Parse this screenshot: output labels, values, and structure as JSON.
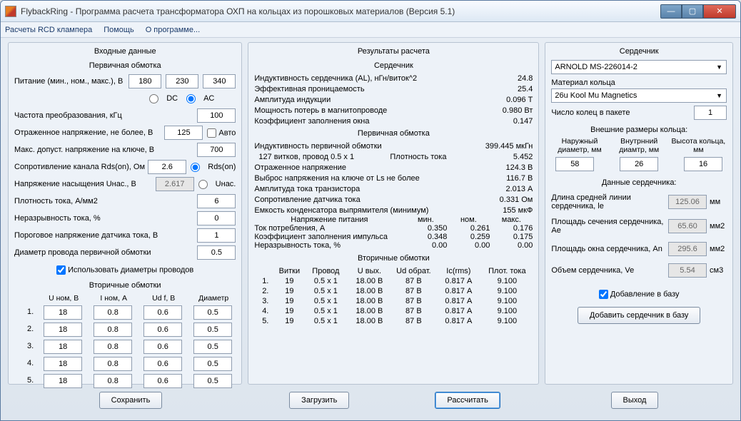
{
  "window": {
    "title": "FlybackRing - Программа расчета трансформатора ОХП на кольцах из порошковых материалов (Версия 5.1)"
  },
  "menu": {
    "rcd": "Расчеты RCD клампера",
    "help": "Помощь",
    "about": "О программе..."
  },
  "left": {
    "title": "Входные данные",
    "primary_heading": "Первичная обмотка",
    "supply_label": "Питание (мин., ном., макс.), В",
    "supply": {
      "min": "180",
      "nom": "230",
      "max": "340"
    },
    "dc_label": "DC",
    "ac_label": "AC",
    "ac_checked": true,
    "freq_label": "Частота преобразования, кГц",
    "freq": "100",
    "vrefl_label": "Отраженное напряжение, не более, В",
    "vrefl": "125",
    "auto_label": "Авто",
    "vds_label": "Макс. допуст. напряжение на ключе, В",
    "vds": "700",
    "rdson_label": "Сопротивление канала Rds(on), Ом",
    "rdson_val": "2.6",
    "rdson_radio": "Rds(on)",
    "usat_label": "Напряжение насыщения Uнас., В",
    "usat_val": "2.617",
    "usat_radio": "Uнас.",
    "jdens_label": "Плотность тока, А/мм2",
    "jdens": "6",
    "discont_label": "Неразрывность тока, %",
    "discont": "0",
    "vthr_label": "Пороговое напряжение датчика тока, В",
    "vthr": "1",
    "dprim_label": "Диаметр провода первичной обмотки",
    "dprim": "0.5",
    "use_diam_label": "Использовать диаметры проводов",
    "secondary_heading": "Вторичные обмотки",
    "sec_headers": [
      "U ном, В",
      "I ном, А",
      "Ud f, B",
      "Диаметр"
    ],
    "sec_rows": [
      {
        "n": "1.",
        "u": "18",
        "i": "0.8",
        "ud": "0.6",
        "d": "0.5"
      },
      {
        "n": "2.",
        "u": "18",
        "i": "0.8",
        "ud": "0.6",
        "d": "0.5"
      },
      {
        "n": "3.",
        "u": "18",
        "i": "0.8",
        "ud": "0.6",
        "d": "0.5"
      },
      {
        "n": "4.",
        "u": "18",
        "i": "0.8",
        "ud": "0.6",
        "d": "0.5"
      },
      {
        "n": "5.",
        "u": "18",
        "i": "0.8",
        "ud": "0.6",
        "d": "0.5"
      }
    ]
  },
  "mid": {
    "title": "Результаты расчета",
    "core_heading": "Сердечник",
    "al_label": "Индуктивность сердечника (AL), нГн/виток^2",
    "al": "24.8",
    "mueff_label": "Эффективная проницаемость",
    "mueff": "25.4",
    "bamp_label": "Амплитуда индукции",
    "bamp": "0.096 Т",
    "ploss_label": "Мощность потерь в магнитопроводе",
    "ploss": "0.980 Вт",
    "kfill_label": "Коэффициент заполнения окна",
    "kfill": "0.147",
    "prim_heading": "Первичная обмотка",
    "lprim_label": "Индуктивность первичной обмотки",
    "lprim": "399.445 мкГн",
    "turns_text": "127 витков, провод 0.5 x 1",
    "jtxt": "Плотность тока",
    "jval": "5.452",
    "vref_label": "Отраженное напряжение",
    "vref": "124.3 В",
    "vspike_label": "Выброс напряжения на ключе от Ls не более",
    "vspike": "116.7 В",
    "ipk_label": "Амплитуда тока транзистора",
    "ipk": "2.013 А",
    "rsense_label": "Сопротивление датчика тока",
    "rsense": "0.331 Ом",
    "crect_label": "Емкость конденсатора выпрямителя (минимум)",
    "crect": "155 мкФ",
    "supply3_label": "Напряжение питания",
    "col_min": "мин.",
    "col_nom": "ном.",
    "col_max": "макс.",
    "iin_label": "Ток потребления, А",
    "iin": [
      "0.350",
      "0.261",
      "0.176"
    ],
    "duty_label": "Коэффициент заполнения импульса",
    "duty": [
      "0.348",
      "0.259",
      "0.175"
    ],
    "cont_label": "Неразрывность тока, %",
    "cont": [
      "0.00",
      "0.00",
      "0.00"
    ],
    "sec_heading": "Вторичные обмотки",
    "sec_headers": [
      "Витки",
      "Провод",
      "U вых.",
      "Ud обрат.",
      "Ic(rms)",
      "Плот. тока"
    ],
    "sec_rows": [
      {
        "n": "1.",
        "turns": "19",
        "wire": "0.5 x 1",
        "uout": "18.00 В",
        "urev": "87 В",
        "ic": "0.817 А",
        "j": "9.100"
      },
      {
        "n": "2.",
        "turns": "19",
        "wire": "0.5 x 1",
        "uout": "18.00 В",
        "urev": "87 В",
        "ic": "0.817 А",
        "j": "9.100"
      },
      {
        "n": "3.",
        "turns": "19",
        "wire": "0.5 x 1",
        "uout": "18.00 В",
        "urev": "87 В",
        "ic": "0.817 А",
        "j": "9.100"
      },
      {
        "n": "4.",
        "turns": "19",
        "wire": "0.5 x 1",
        "uout": "18.00 В",
        "urev": "87 В",
        "ic": "0.817 А",
        "j": "9.100"
      },
      {
        "n": "5.",
        "turns": "19",
        "wire": "0.5 x 1",
        "uout": "18.00 В",
        "urev": "87 В",
        "ic": "0.817 А",
        "j": "9.100"
      }
    ]
  },
  "right": {
    "title": "Сердечник",
    "core_select": "ARNOLD MS-226014-2",
    "mat_label": "Материал кольца",
    "mat_select": "26u Kool Mu Magnetics",
    "nrings_label": "Число колец в пакете",
    "nrings": "1",
    "ext_dim_heading": "Внешние размеры кольца:",
    "dim_headers": [
      "Наружный диаметр, мм",
      "Внутрнний диамтр, мм",
      "Высота кольца, мм"
    ],
    "dims": [
      "58",
      "26",
      "16"
    ],
    "core_data_heading": "Данные сердечника:",
    "le_label": "Длина средней линии сердечника, le",
    "le": "125.06",
    "le_unit": "мм",
    "ae_label": "Площадь сечения сердечника, Ae",
    "ae": "65.60",
    "ae_unit": "мм2",
    "an_label": "Площадь окна сердечника, An",
    "an": "295.6",
    "an_unit": "мм2",
    "ve_label": "Объем сердечника, Ve",
    "ve": "5.54",
    "ve_unit": "см3",
    "add_db_chk": "Добавление в базу",
    "add_db_btn": "Добавить сердечник в базу"
  },
  "buttons": {
    "save": "Сохранить",
    "load": "Загрузить",
    "calc": "Рассчитать",
    "exit": "Выход"
  }
}
